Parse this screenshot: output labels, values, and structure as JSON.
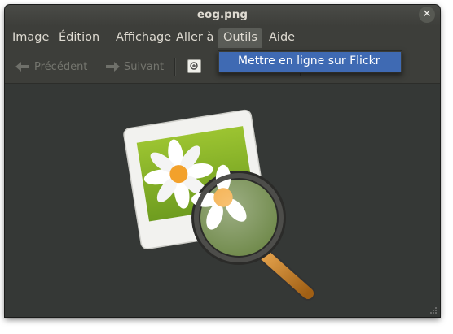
{
  "window": {
    "title": "eog.png",
    "close_glyph": "✕"
  },
  "menubar": {
    "items": [
      {
        "label": "Image"
      },
      {
        "label": "Édition"
      },
      {
        "label": "Affichage"
      },
      {
        "label": "Aller à"
      },
      {
        "label": "Outils"
      },
      {
        "label": "Aide"
      }
    ],
    "open_menu": "Outils"
  },
  "toolbar": {
    "previous_label": "Précédent",
    "next_label": "Suivant"
  },
  "dropdown": {
    "items": [
      {
        "label": "Mettre en ligne sur Flickr"
      }
    ]
  },
  "image": {
    "icon": "image-viewer-magnifier-icon"
  },
  "colors": {
    "window_bg": "#373a37",
    "menu_highlight": "#3f6ab3",
    "toolbar_accent": "#e07a1f"
  }
}
